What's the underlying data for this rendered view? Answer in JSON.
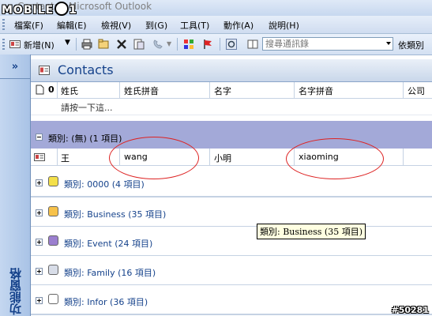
{
  "window": {
    "title": "Contacts - Microsoft Outlook",
    "logo_text": "MOBILE01"
  },
  "menu": [
    {
      "label": "檔案(F)"
    },
    {
      "label": "編輯(E)"
    },
    {
      "label": "檢視(V)"
    },
    {
      "label": "到(G)"
    },
    {
      "label": "工具(T)"
    },
    {
      "label": "動作(A)"
    },
    {
      "label": "說明(H)"
    }
  ],
  "toolbar": {
    "new_label": "新增(N)",
    "search_placeholder": "搜尋通訊錄",
    "category_label": "依類別"
  },
  "nav": {
    "collapse": "»",
    "label": "功能窗格"
  },
  "contacts": {
    "title": "Contacts"
  },
  "columns": [
    "姓氏",
    "姓氏拼音",
    "名字",
    "名字拼音",
    "公司"
  ],
  "new_row_placeholder": "請按一下這...",
  "expanded_group": {
    "label": "類別: (無) (1 項目)"
  },
  "contact": {
    "last_name": "王",
    "last_name_pinyin": "wang",
    "first_name": "小明",
    "first_name_pinyin": "xiaoming"
  },
  "groups": [
    {
      "label": "類別: 0000 (4 項目)",
      "color": "#f4e04a"
    },
    {
      "label": "類別: Business (35 項目)",
      "color": "#f7c24a"
    },
    {
      "label": "類別: Event (24 項目)",
      "color": "#9b7fcf"
    },
    {
      "label": "類別: Family (16 項目)",
      "color": "#d8dde8"
    },
    {
      "label": "類別: Infor (36 項目)",
      "color": "#ffffff"
    }
  ],
  "tooltip": "類別: Business (35 項目)",
  "watermark": "#50281"
}
